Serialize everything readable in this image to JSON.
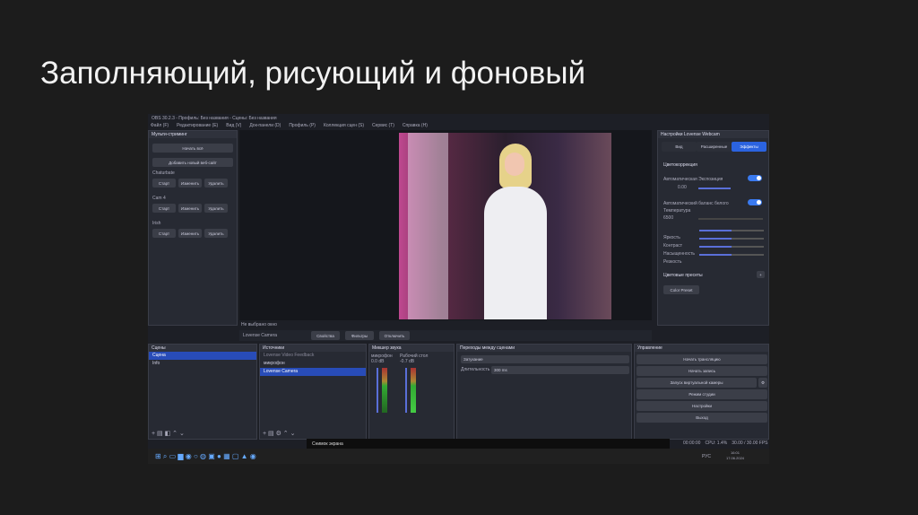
{
  "slide_title": "Заполняющий, рисующий и фоновый",
  "obs": {
    "window_title": "OBS 30.2.3 - Профиль: Без названия - Сцены: Без названия",
    "menu": [
      "Файл (F)",
      "Редактирование (E)",
      "Вид (V)",
      "Док-панели (D)",
      "Профиль (P)",
      "Коллекция сцен (S)",
      "Сервис (T)",
      "Справка (H)"
    ],
    "multistream": {
      "title": "Мульти-стриминг",
      "start_all": "Начать всё",
      "add_site": "Добавить новый веб-сайт",
      "groups": [
        {
          "name": "Chaturbate"
        },
        {
          "name": "Cam 4"
        },
        {
          "name": "Irish"
        }
      ],
      "start": "Старт",
      "edit": "Изменить",
      "delete": "Удалить"
    },
    "preview_bar": {
      "mode": "Не выбрано окно",
      "source": "Lovense Camera",
      "properties": "Свойства",
      "filters": "Фильтры",
      "disable": "Отключить"
    },
    "scenes": {
      "title": "Сцены",
      "items": [
        "Сцена",
        "Info"
      ]
    },
    "sources": {
      "title": "Источники",
      "items": [
        "Lovense Video Feedback",
        "микрофон",
        "Lovense Camera"
      ]
    },
    "mixer": {
      "title": "Микшер звука",
      "channels": [
        {
          "name": "микрофон",
          "db": "0.0 dB"
        },
        {
          "name": "Рабочий стол",
          "db": "-0.7 dB"
        }
      ]
    },
    "transitions": {
      "title": "Переходы между сценами",
      "type": "Затухание",
      "duration_label": "Длительность",
      "duration": "300 ms"
    },
    "controls": {
      "title": "Управление",
      "items": [
        "Начать трансляцию",
        "Начать запись",
        "Запуск виртуальной камеры",
        "Режим студии",
        "Настройки",
        "Выход"
      ]
    },
    "status": {
      "cpu": "CPU: 1.4%",
      "fps": "30.00 / 30.00 FPS",
      "time": "00:00:00"
    },
    "webcam": {
      "title": "Настройки Lovense Webcam",
      "tabs": [
        "Вид",
        "Расширенные",
        "Эффекты"
      ],
      "active_tab": 2,
      "section": "Цветокоррекция",
      "auto_exposure": "Автоматическая Экспозиция",
      "exposure_value": "0.00",
      "auto_wb": "Автоматический баланс белого",
      "temperature": "Температура",
      "temp_value": "6500",
      "sliders": [
        {
          "label": "Яркость",
          "value": 0.5
        },
        {
          "label": "Контраст",
          "value": 0.5
        },
        {
          "label": "Насыщенность",
          "value": 0.5
        },
        {
          "label": "Резкость",
          "value": 0.5
        }
      ],
      "presets": "Цветовые пресеты",
      "preset": "Color Preset"
    }
  },
  "taskbar": {
    "window": "Снимок экрана",
    "lang": "РУС",
    "time": "16:01",
    "date": "17.06.2024"
  }
}
